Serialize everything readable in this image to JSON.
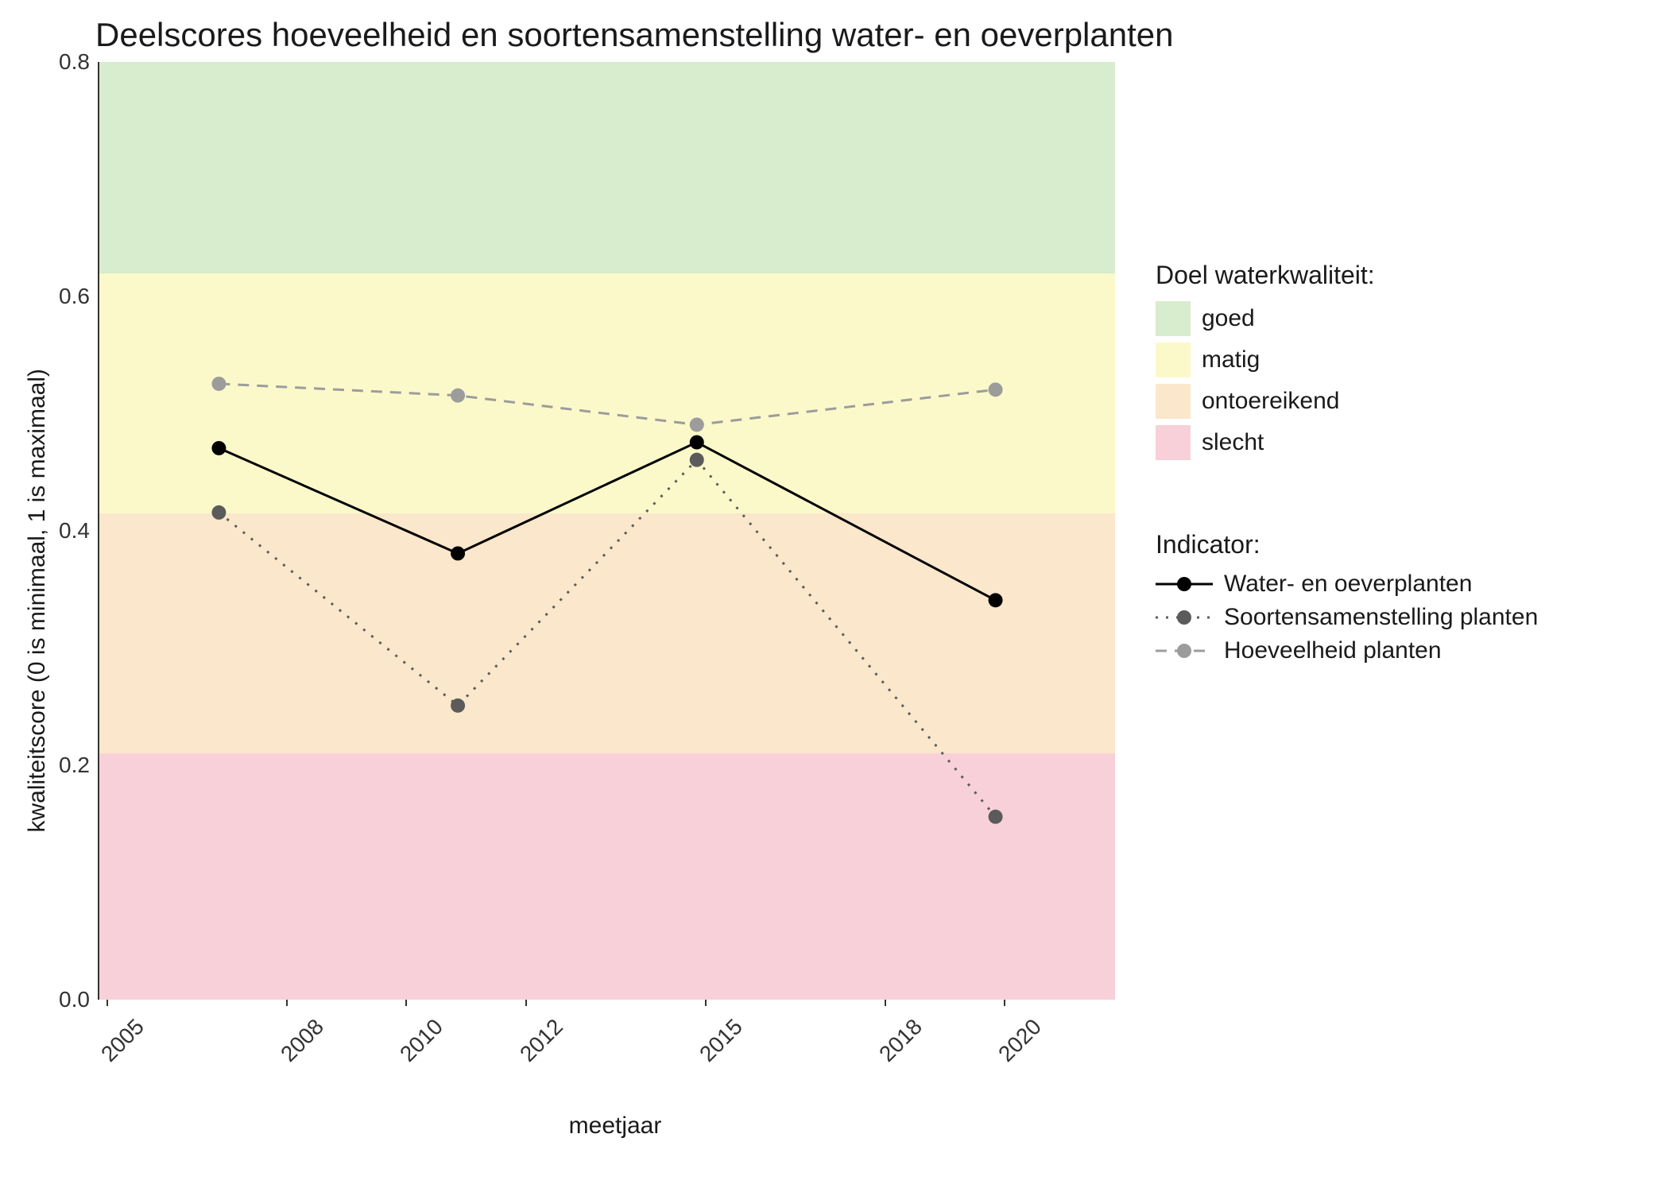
{
  "chart_data": {
    "type": "line",
    "title": "Deelscores hoeveelheid en soortensamenstelling water- en oeverplanten",
    "xlabel": "meetjaar",
    "ylabel": "kwaliteitscore (0 is minimaal, 1 is maximaal)",
    "xlim": [
      2005,
      2022
    ],
    "ylim": [
      0.0,
      0.8
    ],
    "x_ticks": [
      2005,
      2008,
      2010,
      2012,
      2015,
      2018,
      2020
    ],
    "y_ticks": [
      0.0,
      0.2,
      0.4,
      0.6,
      0.8
    ],
    "x": [
      2007,
      2011,
      2015,
      2020
    ],
    "series": [
      {
        "name": "Water- en oeverplanten",
        "values": [
          0.47,
          0.38,
          0.475,
          0.34
        ],
        "color": "#000000",
        "dash": "solid",
        "marker": "#000000"
      },
      {
        "name": "Soortensamenstelling planten",
        "values": [
          0.415,
          0.25,
          0.46,
          0.155
        ],
        "color": "#5b5b5b",
        "dash": "dotted",
        "marker": "#5b5b5b"
      },
      {
        "name": "Hoeveelheid planten",
        "values": [
          0.525,
          0.515,
          0.49,
          0.52
        ],
        "color": "#9c9c9c",
        "dash": "dashed",
        "marker": "#9c9c9c"
      }
    ],
    "bands": [
      {
        "name": "goed",
        "from": 0.62,
        "to": 0.8,
        "color": "#d8ecce"
      },
      {
        "name": "matig",
        "from": 0.415,
        "to": 0.62,
        "color": "#fbf9ca"
      },
      {
        "name": "ontoereikend",
        "from": 0.21,
        "to": 0.415,
        "color": "#fbe7cb"
      },
      {
        "name": "slecht",
        "from": 0.0,
        "to": 0.21,
        "color": "#f8d0d9"
      }
    ],
    "legend_bands_title": "Doel waterkwaliteit:",
    "legend_series_title": "Indicator:"
  }
}
